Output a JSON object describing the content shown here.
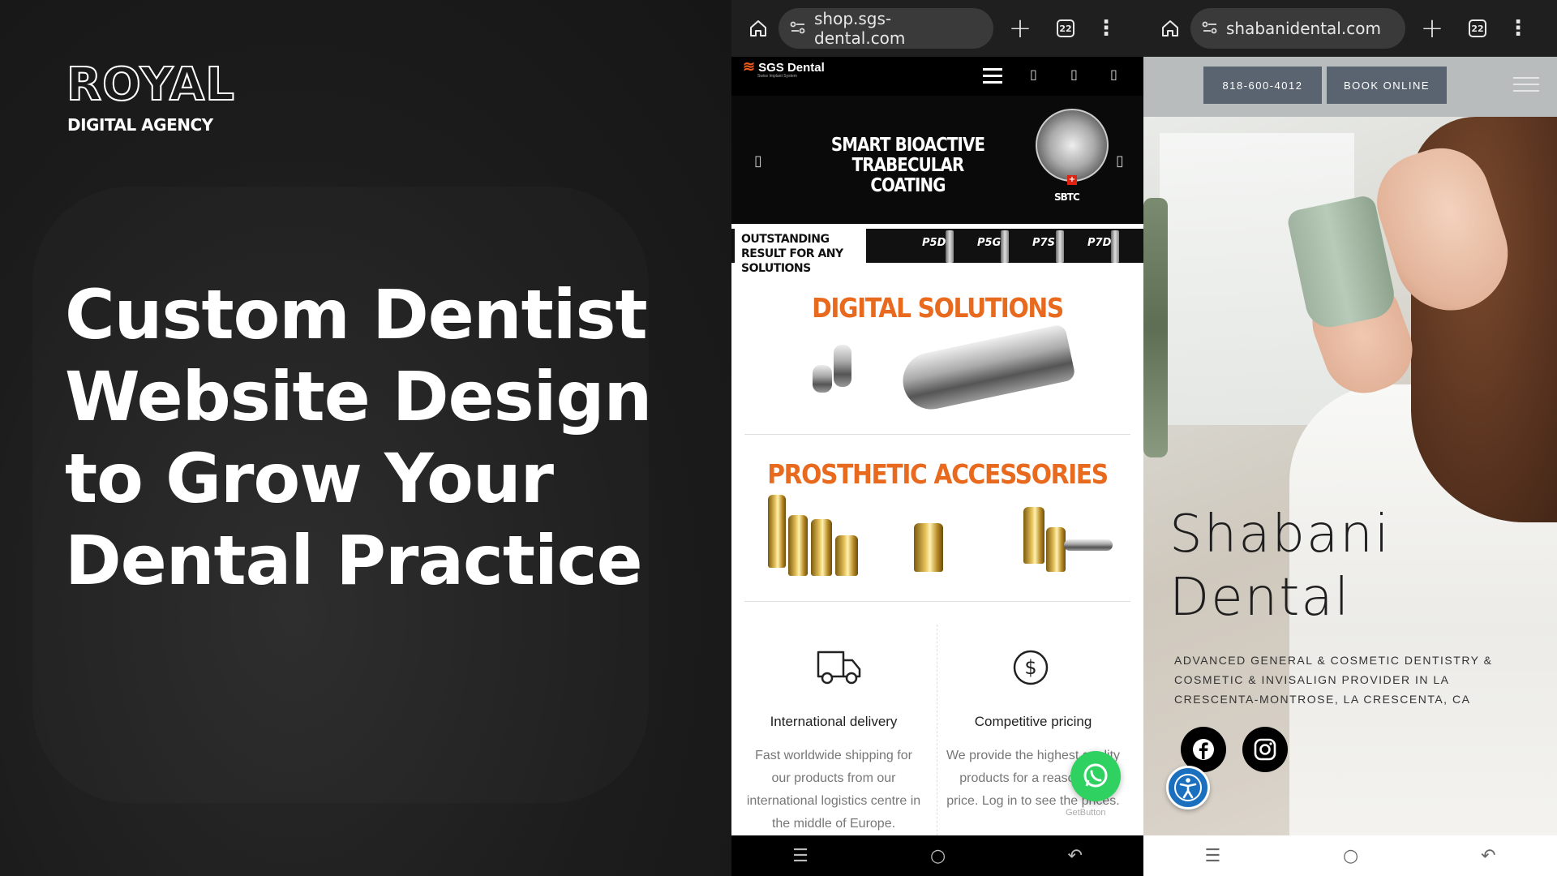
{
  "brand": {
    "logo_main": "ROYAL",
    "logo_sub": "DIGITAL AGENCY"
  },
  "headline": "Custom Dentist Website Design to Grow Your Dental Practice",
  "phone_left": {
    "url": "shop.sgs-dental.com",
    "tab_count": "22",
    "site_logo": "SGS Dental",
    "site_logo_tagline": "Swiss Implant System",
    "hero_title": "SMART BIOACTIVE TRABECULAR COATING",
    "badge": "SBTC",
    "strip_text": "OUTSTANDING RESULT FOR ANY SOLUTIONS",
    "strip_items": [
      "P5D",
      "P5G",
      "P7S",
      "P7D"
    ],
    "section_digital": "DIGITAL SOLUTIONS",
    "section_prosthetic": "PROSTHETIC ACCESSORIES",
    "features": [
      {
        "icon": "truck-icon",
        "title": "International delivery",
        "text": "Fast worldwide shipping for our products from our international logistics centre in the middle of Europe."
      },
      {
        "icon": "dollar-icon",
        "title": "Competitive pricing",
        "text": "We provide the highest quality products for a reasonable price. Log in to see the prices."
      }
    ],
    "getbutton": "GetButton"
  },
  "phone_right": {
    "url": "shabanidental.com",
    "tab_count": "22",
    "phone_button": "818-600-4012",
    "book_button": "BOOK ONLINE",
    "title": "Shabani Dental",
    "subtitle": "ADVANCED GENERAL & COSMETIC DENTISTRY & COSMETIC & INVISALIGN PROVIDER IN LA CRESCENTA-MONTROSE, LA CRESCENTA, CA"
  },
  "colors": {
    "accent_orange": "#e86a1f",
    "whatsapp": "#2fd160",
    "accessibility": "#1a6fbf"
  }
}
